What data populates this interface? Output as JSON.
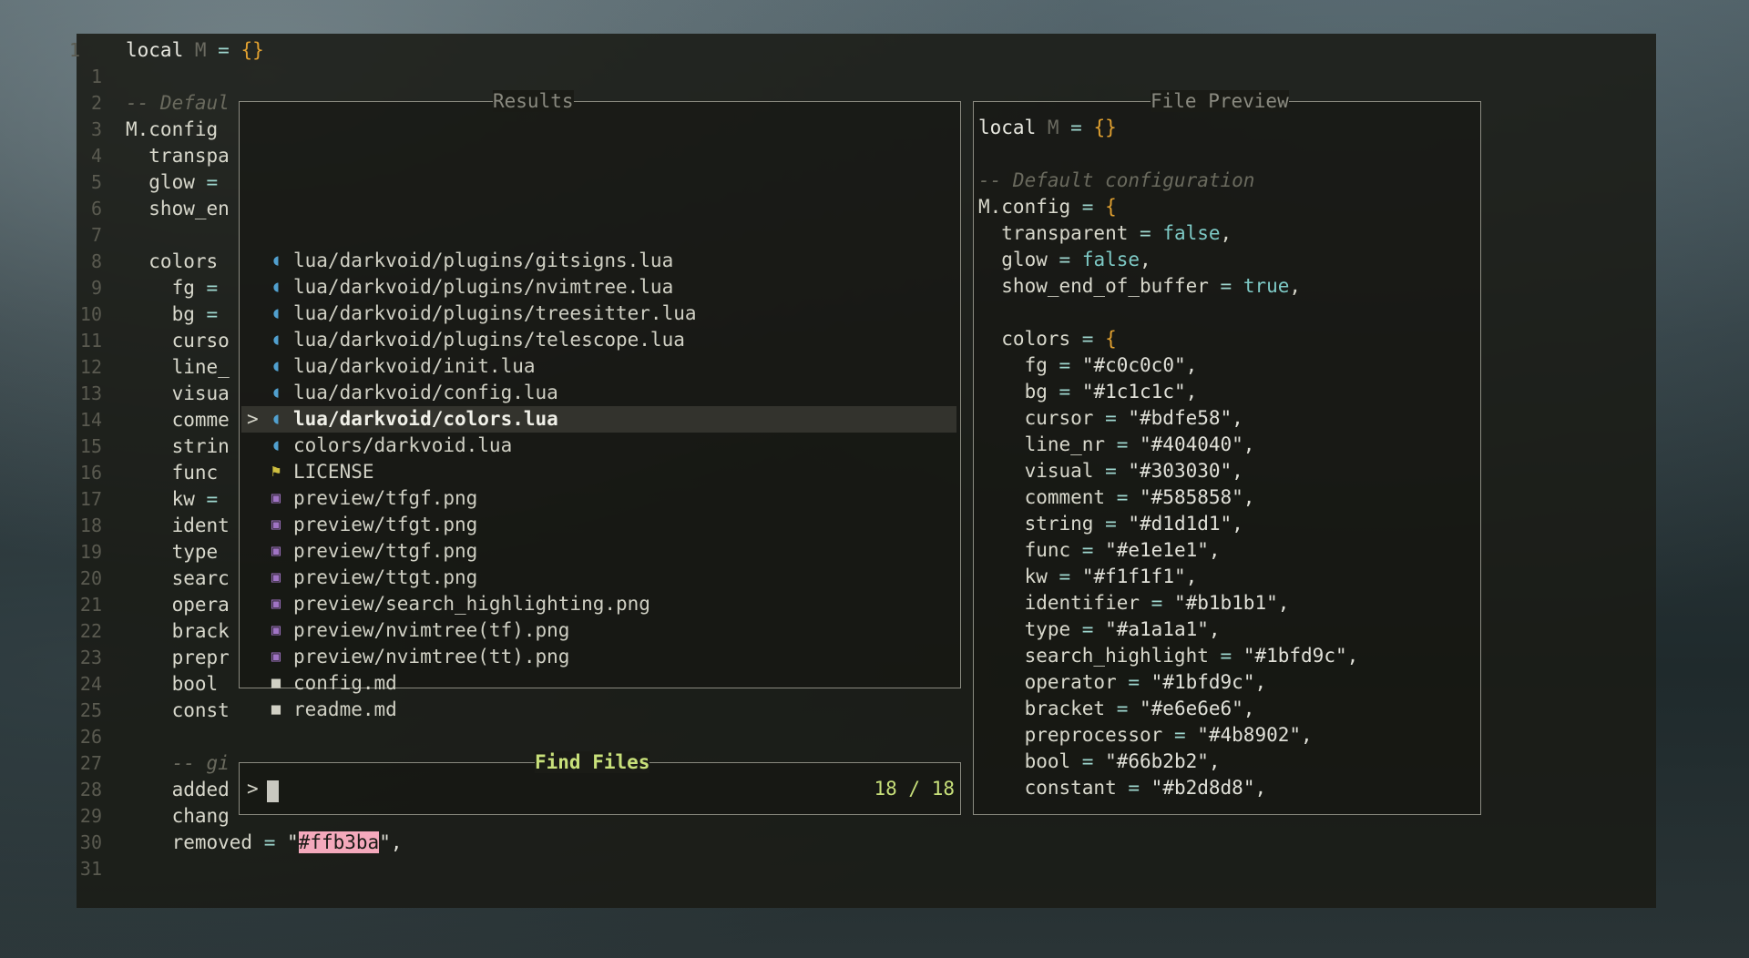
{
  "editor": {
    "lines": [
      {
        "n": "1",
        "code": [
          {
            "t": "local ",
            "c": "kw"
          },
          {
            "t": "M",
            "c": "num"
          },
          {
            "t": " = ",
            "c": "op"
          },
          {
            "t": "{}",
            "c": "brace"
          }
        ]
      },
      {
        "n": "1",
        "code": []
      },
      {
        "n": "2",
        "code": [
          {
            "t": "-- Defaul",
            "c": "cmt"
          }
        ]
      },
      {
        "n": "3",
        "code": [
          {
            "t": "M.config",
            "c": "ident"
          }
        ]
      },
      {
        "n": "4",
        "code": [
          {
            "t": "  transpa",
            "c": "ident"
          }
        ]
      },
      {
        "n": "5",
        "code": [
          {
            "t": "  glow ",
            "c": "ident"
          },
          {
            "t": "=",
            "c": "op"
          }
        ]
      },
      {
        "n": "6",
        "code": [
          {
            "t": "  show_en",
            "c": "ident"
          }
        ]
      },
      {
        "n": "7",
        "code": []
      },
      {
        "n": "8",
        "code": [
          {
            "t": "  colors",
            "c": "ident"
          }
        ]
      },
      {
        "n": "9",
        "code": [
          {
            "t": "    fg ",
            "c": "ident"
          },
          {
            "t": "=",
            "c": "op"
          }
        ]
      },
      {
        "n": "10",
        "code": [
          {
            "t": "    bg ",
            "c": "ident"
          },
          {
            "t": "=",
            "c": "op"
          }
        ]
      },
      {
        "n": "11",
        "code": [
          {
            "t": "    curso",
            "c": "ident"
          }
        ]
      },
      {
        "n": "12",
        "code": [
          {
            "t": "    line_",
            "c": "ident"
          }
        ]
      },
      {
        "n": "13",
        "code": [
          {
            "t": "    visua",
            "c": "ident"
          }
        ]
      },
      {
        "n": "14",
        "code": [
          {
            "t": "    comme",
            "c": "ident"
          }
        ]
      },
      {
        "n": "15",
        "code": [
          {
            "t": "    strin",
            "c": "ident"
          }
        ]
      },
      {
        "n": "16",
        "code": [
          {
            "t": "    func",
            "c": "ident"
          }
        ]
      },
      {
        "n": "17",
        "code": [
          {
            "t": "    kw ",
            "c": "ident"
          },
          {
            "t": "=",
            "c": "op"
          }
        ]
      },
      {
        "n": "18",
        "code": [
          {
            "t": "    ident",
            "c": "ident"
          }
        ]
      },
      {
        "n": "19",
        "code": [
          {
            "t": "    type",
            "c": "ident"
          }
        ]
      },
      {
        "n": "20",
        "code": [
          {
            "t": "    searc",
            "c": "ident"
          }
        ]
      },
      {
        "n": "21",
        "code": [
          {
            "t": "    opera",
            "c": "ident"
          }
        ]
      },
      {
        "n": "22",
        "code": [
          {
            "t": "    brack",
            "c": "ident"
          }
        ]
      },
      {
        "n": "23",
        "code": [
          {
            "t": "    prepr",
            "c": "ident"
          }
        ]
      },
      {
        "n": "24",
        "code": [
          {
            "t": "    bool",
            "c": "ident"
          }
        ]
      },
      {
        "n": "25",
        "code": [
          {
            "t": "    const",
            "c": "ident"
          }
        ]
      },
      {
        "n": "26",
        "code": []
      },
      {
        "n": "27",
        "code": [
          {
            "t": "    -- gi",
            "c": "cmt"
          }
        ]
      },
      {
        "n": "28",
        "code": [
          {
            "t": "    added",
            "c": "ident"
          }
        ]
      },
      {
        "n": "29",
        "code": [
          {
            "t": "    chang",
            "c": "ident"
          }
        ]
      },
      {
        "n": "30",
        "code": [
          {
            "t": "    removed ",
            "c": "ident"
          },
          {
            "t": "= ",
            "c": "op"
          },
          {
            "t": "\"",
            "c": "str"
          },
          {
            "t": "#ffb3ba",
            "c": "hl"
          },
          {
            "t": "\",",
            "c": "str"
          }
        ]
      },
      {
        "n": "31",
        "code": []
      }
    ]
  },
  "results_panel": {
    "title": "Results",
    "items": [
      {
        "icon": "lua",
        "path": "lua/darkvoid/plugins/gitsigns.lua",
        "selected": false
      },
      {
        "icon": "lua",
        "path": "lua/darkvoid/plugins/nvimtree.lua",
        "selected": false
      },
      {
        "icon": "lua",
        "path": "lua/darkvoid/plugins/treesitter.lua",
        "selected": false
      },
      {
        "icon": "lua",
        "path": "lua/darkvoid/plugins/telescope.lua",
        "selected": false
      },
      {
        "icon": "lua",
        "path": "lua/darkvoid/init.lua",
        "selected": false
      },
      {
        "icon": "lua",
        "path": "lua/darkvoid/config.lua",
        "selected": false
      },
      {
        "icon": "lua",
        "path": "lua/darkvoid/colors.lua",
        "selected": true
      },
      {
        "icon": "lua",
        "path": "colors/darkvoid.lua",
        "selected": false
      },
      {
        "icon": "license",
        "path": "LICENSE",
        "selected": false
      },
      {
        "icon": "image",
        "path": "preview/tfgf.png",
        "selected": false
      },
      {
        "icon": "image",
        "path": "preview/tfgt.png",
        "selected": false
      },
      {
        "icon": "image",
        "path": "preview/ttgf.png",
        "selected": false
      },
      {
        "icon": "image",
        "path": "preview/ttgt.png",
        "selected": false
      },
      {
        "icon": "image",
        "path": "preview/search_highlighting.png",
        "selected": false
      },
      {
        "icon": "image",
        "path": "preview/nvimtree(tf).png",
        "selected": false
      },
      {
        "icon": "image",
        "path": "preview/nvimtree(tt).png",
        "selected": false
      },
      {
        "icon": "markdown",
        "path": "config.md",
        "selected": false
      },
      {
        "icon": "markdown",
        "path": "readme.md",
        "selected": false
      }
    ],
    "selection_marker": ">"
  },
  "prompt_panel": {
    "title": "Find Files",
    "prompt": ">",
    "value": "",
    "count": "18 / 18"
  },
  "preview_panel": {
    "title": "File Preview",
    "lines": [
      [
        {
          "t": "local ",
          "c": "kw"
        },
        {
          "t": "M",
          "c": "num"
        },
        {
          "t": " = ",
          "c": "op"
        },
        {
          "t": "{}",
          "c": "brace"
        }
      ],
      [],
      [
        {
          "t": "-- Default configuration",
          "c": "cmt"
        }
      ],
      [
        {
          "t": "M.config ",
          "c": "ident"
        },
        {
          "t": "= ",
          "c": "op"
        },
        {
          "t": "{",
          "c": "brace"
        }
      ],
      [
        {
          "t": "  transparent ",
          "c": "ident"
        },
        {
          "t": "= ",
          "c": "op"
        },
        {
          "t": "false",
          "c": "bool"
        },
        {
          "t": ",",
          "c": "ident"
        }
      ],
      [
        {
          "t": "  glow ",
          "c": "ident"
        },
        {
          "t": "= ",
          "c": "op"
        },
        {
          "t": "false",
          "c": "bool"
        },
        {
          "t": ",",
          "c": "ident"
        }
      ],
      [
        {
          "t": "  show_end_of_buffer ",
          "c": "ident"
        },
        {
          "t": "= ",
          "c": "op"
        },
        {
          "t": "true",
          "c": "bool"
        },
        {
          "t": ",",
          "c": "ident"
        }
      ],
      [],
      [
        {
          "t": "  colors ",
          "c": "ident"
        },
        {
          "t": "= ",
          "c": "op"
        },
        {
          "t": "{",
          "c": "brace"
        }
      ],
      [
        {
          "t": "    fg ",
          "c": "ident"
        },
        {
          "t": "= ",
          "c": "op"
        },
        {
          "t": "\"#c0c0c0\",",
          "c": "str"
        }
      ],
      [
        {
          "t": "    bg ",
          "c": "ident"
        },
        {
          "t": "= ",
          "c": "op"
        },
        {
          "t": "\"#1c1c1c\",",
          "c": "str"
        }
      ],
      [
        {
          "t": "    cursor ",
          "c": "ident"
        },
        {
          "t": "= ",
          "c": "op"
        },
        {
          "t": "\"#bdfe58\",",
          "c": "str"
        }
      ],
      [
        {
          "t": "    line_nr ",
          "c": "ident"
        },
        {
          "t": "= ",
          "c": "op"
        },
        {
          "t": "\"#404040\",",
          "c": "str"
        }
      ],
      [
        {
          "t": "    visual ",
          "c": "ident"
        },
        {
          "t": "= ",
          "c": "op"
        },
        {
          "t": "\"#303030\",",
          "c": "str"
        }
      ],
      [
        {
          "t": "    comment ",
          "c": "ident"
        },
        {
          "t": "= ",
          "c": "op"
        },
        {
          "t": "\"#585858\",",
          "c": "str"
        }
      ],
      [
        {
          "t": "    string ",
          "c": "ident"
        },
        {
          "t": "= ",
          "c": "op"
        },
        {
          "t": "\"#d1d1d1\",",
          "c": "str"
        }
      ],
      [
        {
          "t": "    func ",
          "c": "ident"
        },
        {
          "t": "= ",
          "c": "op"
        },
        {
          "t": "\"#e1e1e1\",",
          "c": "str"
        }
      ],
      [
        {
          "t": "    kw ",
          "c": "ident"
        },
        {
          "t": "= ",
          "c": "op"
        },
        {
          "t": "\"#f1f1f1\",",
          "c": "str"
        }
      ],
      [
        {
          "t": "    identifier ",
          "c": "ident"
        },
        {
          "t": "= ",
          "c": "op"
        },
        {
          "t": "\"#b1b1b1\",",
          "c": "str"
        }
      ],
      [
        {
          "t": "    type ",
          "c": "ident"
        },
        {
          "t": "= ",
          "c": "op"
        },
        {
          "t": "\"#a1a1a1\",",
          "c": "str"
        }
      ],
      [
        {
          "t": "    search_highlight ",
          "c": "ident"
        },
        {
          "t": "= ",
          "c": "op"
        },
        {
          "t": "\"#1bfd9c\",",
          "c": "str"
        }
      ],
      [
        {
          "t": "    operator ",
          "c": "ident"
        },
        {
          "t": "= ",
          "c": "op"
        },
        {
          "t": "\"#1bfd9c\",",
          "c": "str"
        }
      ],
      [
        {
          "t": "    bracket ",
          "c": "ident"
        },
        {
          "t": "= ",
          "c": "op"
        },
        {
          "t": "\"#e6e6e6\",",
          "c": "str"
        }
      ],
      [
        {
          "t": "    preprocessor ",
          "c": "ident"
        },
        {
          "t": "= ",
          "c": "op"
        },
        {
          "t": "\"#4b8902\",",
          "c": "str"
        }
      ],
      [
        {
          "t": "    bool ",
          "c": "ident"
        },
        {
          "t": "= ",
          "c": "op"
        },
        {
          "t": "\"#66b2b2\",",
          "c": "str"
        }
      ],
      [
        {
          "t": "    constant ",
          "c": "ident"
        },
        {
          "t": "= ",
          "c": "op"
        },
        {
          "t": "\"#b2d8d8\",",
          "c": "str"
        }
      ]
    ]
  },
  "icons": {
    "lua": "lua-file-icon",
    "license": "license-icon",
    "image": "image-file-icon",
    "markdown": "markdown-icon"
  },
  "colors": {
    "accent": "#c8e07a",
    "highlight_bg": "#f4a9bc",
    "lua_icon": "#51a0cf",
    "image_icon": "#a074c4",
    "license_icon": "#d0c040"
  }
}
